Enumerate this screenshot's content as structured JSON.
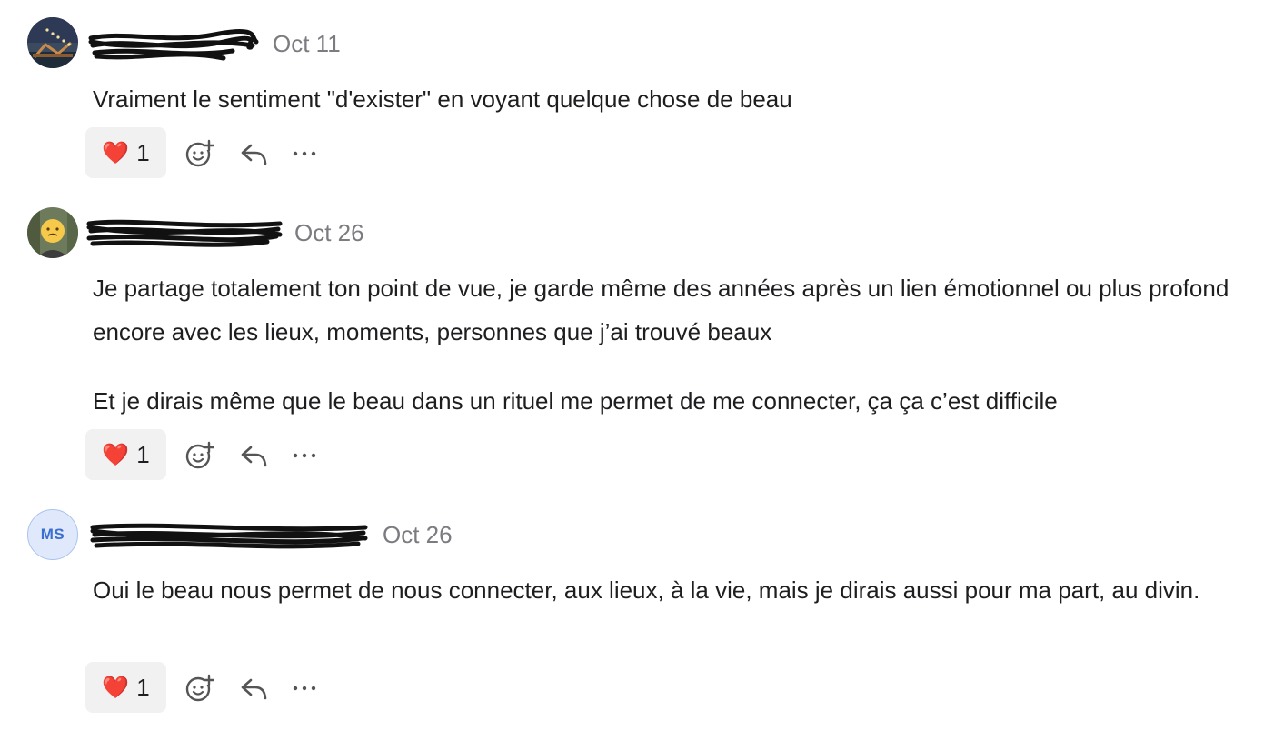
{
  "comments": [
    {
      "avatar": {
        "type": "photo",
        "icon": "bridge-photo-avatar"
      },
      "timestamp": "Oct 11",
      "paragraphs": [
        "Vraiment le sentiment \"d'exister\" en voyant quelque chose de beau"
      ],
      "reaction": {
        "emoji": "❤️",
        "count": "1"
      }
    },
    {
      "avatar": {
        "type": "photo",
        "icon": "face-photo-avatar"
      },
      "timestamp": "Oct 26",
      "paragraphs": [
        "Je partage totalement ton point de vue, je garde même des années après un lien émotionnel ou plus profond encore avec les lieux, moments, personnes que j’ai trouvé beaux",
        "Et je dirais même que le beau dans un rituel me permet de me connecter, ça ça c’est difficile"
      ],
      "reaction": {
        "emoji": "❤️",
        "count": "1"
      }
    },
    {
      "avatar": {
        "type": "initials",
        "initials": "MS"
      },
      "timestamp": "Oct 26",
      "paragraphs": [
        "Oui le beau nous permet de nous connecter, aux lieux, à la vie, mais je dirais aussi pour ma part, au divin."
      ],
      "reaction": {
        "emoji": "❤️",
        "count": "1"
      }
    }
  ],
  "icons": {
    "add_reaction": "add-reaction-icon",
    "reply": "reply-icon",
    "more": "more-options-icon"
  },
  "colors": {
    "reaction_bg": "#f1f1f2",
    "timestamp": "#7b7b80",
    "initials_bg": "#dfe9fb",
    "initials_text": "#3a6fd0"
  }
}
